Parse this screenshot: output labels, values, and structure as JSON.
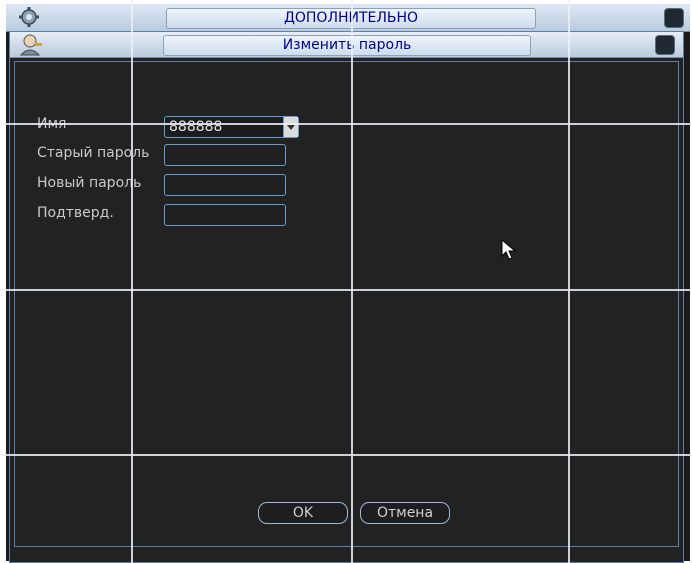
{
  "outer_window": {
    "title": "ДОПОЛНИТЕЛЬНО"
  },
  "dialog": {
    "title": "Изменить пароль",
    "fields": {
      "user_label": "Имя",
      "user_value": "888888",
      "old_password_label": "Старый пароль",
      "new_password_label": "Новый пароль",
      "confirm_label": "Подтверд."
    },
    "buttons": {
      "ok": "OK",
      "cancel": "Отмена"
    }
  },
  "icons": [
    "gear-icon",
    "user-key-icon",
    "close-icon",
    "dropdown-arrow-icon",
    "mouse-cursor-icon"
  ],
  "colors": {
    "title_text": "#000090",
    "field_border": "#6b9cd6",
    "background": "#222222",
    "label_text": "#c9c9c9"
  }
}
